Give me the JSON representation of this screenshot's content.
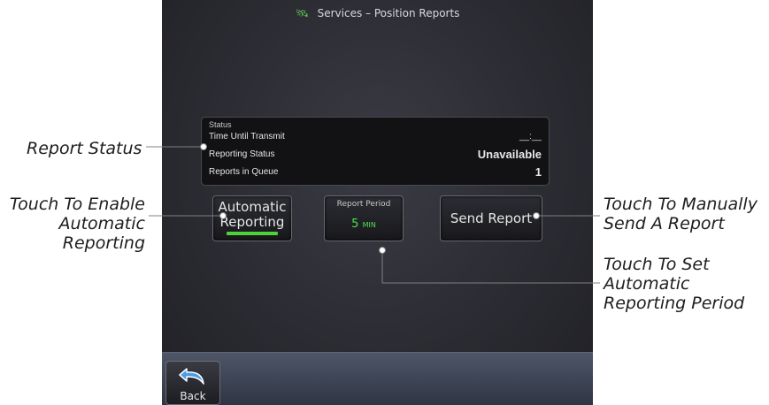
{
  "screen": {
    "title": "Services – Position Reports",
    "title_icon": "satellite-icon",
    "status": {
      "header": "Status",
      "rows": [
        {
          "label": "Time Until Transmit",
          "value": "__:__"
        },
        {
          "label": "Reporting Status",
          "value": "Unavailable"
        },
        {
          "label": "Reports in Queue",
          "value": "1"
        }
      ]
    },
    "buttons": {
      "automatic_line1": "Automatic",
      "automatic_line2": "Reporting",
      "automatic_indicator_color": "#4cd13a",
      "period_caption": "Report Period",
      "period_value": "5",
      "period_unit": "MIN",
      "send": "Send Report"
    },
    "back_label": "Back"
  },
  "callouts": {
    "report_status": "Report Status",
    "enable_automatic_1": "Touch To Enable",
    "enable_automatic_2": "Automatic",
    "enable_automatic_3": "Reporting",
    "manual_send_1": "Touch To Manually",
    "manual_send_2": "Send A Report",
    "set_period_1": "Touch To Set",
    "set_period_2": "Automatic",
    "set_period_3": "Reporting Period"
  },
  "colors": {
    "accent_green": "#4ee04a",
    "screen_bg": "#2a2a31"
  }
}
